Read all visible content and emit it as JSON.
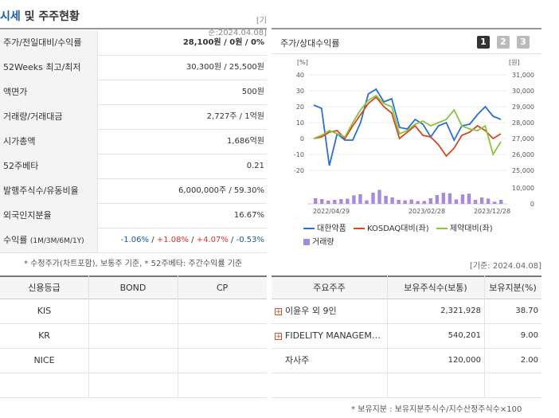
{
  "header": {
    "title_main": "시세",
    "title_rest": " 및 주주현황",
    "base_date": "[기준:2024.04.08]"
  },
  "stats": [
    {
      "label": "주가/전일대비/수익률",
      "value": "28,100원 / 0원 / 0%"
    },
    {
      "label": "52Weeks 최고/최저",
      "value": "30,300원 / 25,500원"
    },
    {
      "label": "액면가",
      "value": "500원"
    },
    {
      "label": "거래량/거래대금",
      "value": "2,727주 / 1억원"
    },
    {
      "label": "시가총액",
      "value": "1,686억원"
    },
    {
      "label": "52주베타",
      "value": "0.21"
    },
    {
      "label": "발행주식수/유동비율",
      "value": "6,000,000주 / 59.30%"
    },
    {
      "label": "외국인지분율",
      "value": "16.67%"
    }
  ],
  "returns": {
    "label": "수익률",
    "periods": "(1M/3M/6M/1Y)",
    "r1m": "-1.06%",
    "r3m": "+1.08%",
    "r6m": "+4.07%",
    "r1y": "-0.53%",
    "sep": "/"
  },
  "stats_note": "* 수정주가(차트포함), 보통주 기준, * 52주베타: 주간수익률 기준",
  "chart": {
    "title": "주가/상대수익률",
    "pages": [
      "1",
      "2",
      "3"
    ],
    "active_page": 1,
    "left_unit": "[%]",
    "right_unit": "[원]",
    "base_date": "[기준: 2024.04.08]"
  },
  "chart_data": {
    "type": "line",
    "x_ticks": [
      "2022/04/29",
      "2023/02/28",
      "2023/12/28"
    ],
    "left_axis": {
      "unit": "%",
      "range": [
        -20,
        40
      ],
      "ticks": [
        40,
        30,
        20,
        10,
        0,
        -10,
        -20
      ]
    },
    "right_axis": {
      "unit": "원",
      "range": [
        25000,
        31000
      ],
      "ticks": [
        "31,000",
        "30,000",
        "29,000",
        "28,000",
        "27,000",
        "26,000",
        "25,000"
      ]
    },
    "volume_axis": {
      "ticks": [
        "10,000",
        "0"
      ],
      "range": [
        0,
        10000
      ]
    },
    "series": [
      {
        "name": "대한약품",
        "axis": "right",
        "color": "#2b6fd1",
        "values": [
          29100,
          28900,
          25300,
          27300,
          26900,
          26900,
          28000,
          29800,
          30100,
          29300,
          29500,
          27700,
          27600,
          28200,
          27900,
          27100,
          27800,
          28000,
          26900,
          27800,
          27900,
          28500,
          29000,
          28400,
          28200
        ]
      },
      {
        "name": "KOSDAQ대비(좌)",
        "axis": "left",
        "color": "#d24a1e",
        "values": [
          0,
          1,
          4,
          5,
          0,
          8,
          15,
          22,
          26,
          20,
          16,
          0,
          4,
          8,
          2,
          1,
          -4,
          -11,
          -6,
          2,
          4,
          8,
          5,
          0,
          3
        ]
      },
      {
        "name": "제약대비(좌)",
        "axis": "left",
        "color": "#8cc43f",
        "values": [
          0,
          2,
          5,
          3,
          1,
          10,
          18,
          24,
          27,
          22,
          20,
          3,
          5,
          9,
          11,
          8,
          10,
          12,
          18,
          8,
          6,
          5,
          8,
          -10,
          -2
        ]
      }
    ],
    "volume": {
      "name": "거래량",
      "color": "#a98ad8",
      "values": [
        3500,
        3000,
        2000,
        2500,
        3000,
        3200,
        5300,
        6000,
        2200,
        7000,
        8800,
        5000,
        4000,
        2500,
        2200,
        2700,
        1700,
        1800,
        3500,
        5500,
        7000,
        6600,
        2800,
        5900,
        6400,
        2500,
        4000,
        3300,
        1300,
        2500
      ]
    }
  },
  "credit": {
    "headers": [
      "신용등급",
      "BOND",
      "CP"
    ],
    "rows": [
      {
        "agency": "KIS",
        "bond": "",
        "cp": ""
      },
      {
        "agency": "KR",
        "bond": "",
        "cp": ""
      },
      {
        "agency": "NICE",
        "bond": "",
        "cp": ""
      },
      {
        "agency": "",
        "bond": "",
        "cp": ""
      }
    ]
  },
  "holders": {
    "headers": [
      "주요주주",
      "보유주식수(보통)",
      "보유지분(%)"
    ],
    "rows": [
      {
        "name": "이윤우 외 9인",
        "shares": "2,321,928",
        "pct": "38.70",
        "expand": true
      },
      {
        "name": "FIDELITY MANAGEM…",
        "shares": "540,201",
        "pct": "9.00",
        "expand": true
      },
      {
        "name": "자사주",
        "shares": "120,000",
        "pct": "2.00",
        "expand": false
      },
      {
        "name": "",
        "shares": "",
        "pct": "",
        "expand": false
      }
    ],
    "note": "* 보유지분 : 보유지분주식수/지수산정주식수×100"
  },
  "colors": {
    "accent": "#1a5aa8",
    "negative": "#1a5aa8",
    "positive": "#e03030"
  }
}
